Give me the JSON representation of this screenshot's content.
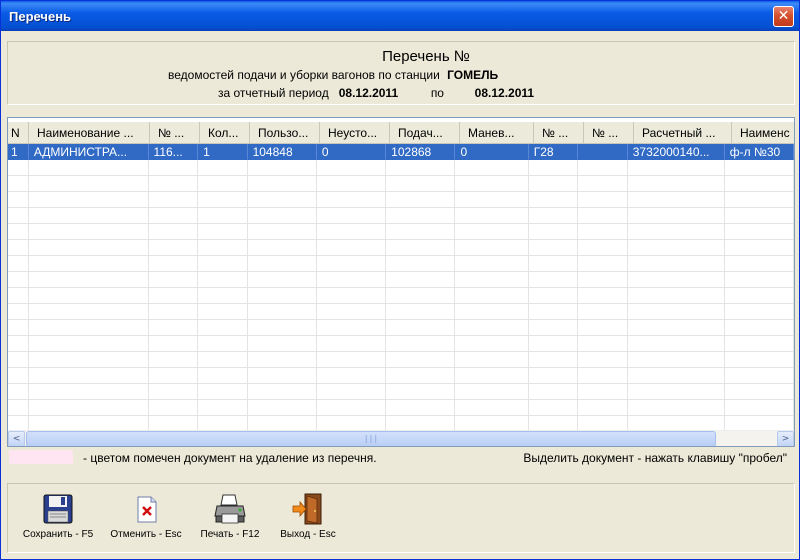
{
  "window": {
    "title": "Перечень",
    "close_glyph": "✕"
  },
  "header": {
    "title": "Перечень №",
    "line2_text": "ведомостей подачи и уборки вагонов по станции",
    "station": "ГОМЕЛЬ",
    "period_label": "за отчетный период",
    "date_from": "08.12.2011",
    "to_label": "по",
    "date_to": "08.12.2011"
  },
  "table": {
    "columns": [
      "N",
      "Наименование ...",
      "№ ...",
      "Кол...",
      "Пользо...",
      "Неусто...",
      "Подач...",
      "Манев...",
      "№ ...",
      "№ ...",
      "Расчетный ...",
      "Наименс"
    ],
    "rows": [
      [
        "1",
        "АДМИНИСТРА...",
        "116...",
        "1",
        "104848",
        "0",
        "102868",
        "0",
        "Г28",
        "",
        "3732000140...",
        "ф-л №30"
      ]
    ],
    "selected_row": 0
  },
  "scrollbar": {
    "left_glyph": "<",
    "right_glyph": ">",
    "thumb_grip": "|||"
  },
  "legend": {
    "swatch_color": "#FFE4F2",
    "text": "- цветом помечен документ на удаление из перечня.",
    "hint": "Выделить документ - нажать клавишу \"пробел\""
  },
  "toolbar": {
    "save_label": "Сохранить - F5",
    "cancel_label": "Отменить - Esc",
    "print_label": "Печать - F12",
    "exit_label": "Выход - Esc"
  },
  "icons": [
    "floppy-disk-icon",
    "delete-document-icon",
    "printer-icon",
    "exit-door-icon"
  ]
}
